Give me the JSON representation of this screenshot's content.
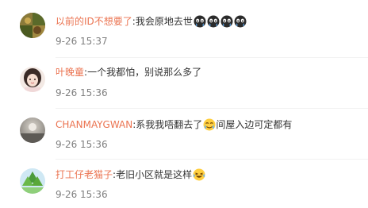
{
  "comments": [
    {
      "username": "以前的ID不想要了",
      "text": "我会原地去世",
      "emoji_icons": [
        "crying-face-icon",
        "crying-face-icon",
        "crying-face-icon",
        "crying-face-icon"
      ],
      "time": "9-26 15:37"
    },
    {
      "username": "叶晚童",
      "text": "一个我都怕，别说那么多了",
      "emoji_icons": [],
      "time": "9-26 15:36"
    },
    {
      "username": "CHANMAYGWAN",
      "text": "系我我唔翻去了",
      "emoji_icons": [
        "tearful-face-icon"
      ],
      "text_after_emoji": "间屋入边可定都有",
      "time": "9-26 15:36"
    },
    {
      "username": "打工仔老猫子",
      "text": "老旧小区就是这样",
      "emoji_icons": [
        "laughing-tears-face-icon"
      ],
      "time": "9-26 15:36"
    }
  ],
  "colors": {
    "username": "#eb7350",
    "text": "#333333",
    "time": "#808080"
  }
}
